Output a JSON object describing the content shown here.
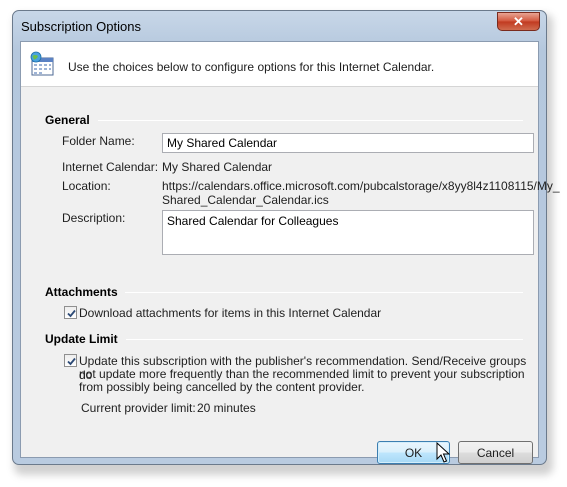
{
  "dialog": {
    "title": "Subscription Options",
    "close_symbol": "✕",
    "banner_text": "Use the choices below to configure options for this Internet Calendar."
  },
  "general": {
    "heading": "General",
    "folder_name_label": "Folder Name:",
    "folder_name_value": "My Shared Calendar",
    "internet_calendar_label": "Internet Calendar:",
    "internet_calendar_value": "My Shared Calendar",
    "location_label": "Location:",
    "location_line1": "https://calendars.office.microsoft.com/pubcalstorage/x8yy8l4z1108115/My_",
    "location_line2": "Shared_Calendar_Calendar.ics",
    "description_label": "Description:",
    "description_value": "Shared Calendar for Colleagues"
  },
  "attachments": {
    "heading": "Attachments",
    "download_label": "Download attachments for items in this Internet Calendar",
    "download_checked": true
  },
  "update_limit": {
    "heading": "Update Limit",
    "update_line1": "Update this subscription with the publisher's recommendation. Send/Receive groups do",
    "update_line2": "not update more frequently than the recommended limit to prevent your subscription",
    "update_line3": "from possibly being cancelled by the content provider.",
    "update_checked": true,
    "provider_limit_label": "Current provider limit:",
    "provider_limit_value": "20 minutes"
  },
  "buttons": {
    "ok": "OK",
    "cancel": "Cancel"
  },
  "icons": {
    "banner_icon": "internet-calendar-icon",
    "close_icon": "close-icon",
    "cursor": "mouse-pointer-icon"
  }
}
